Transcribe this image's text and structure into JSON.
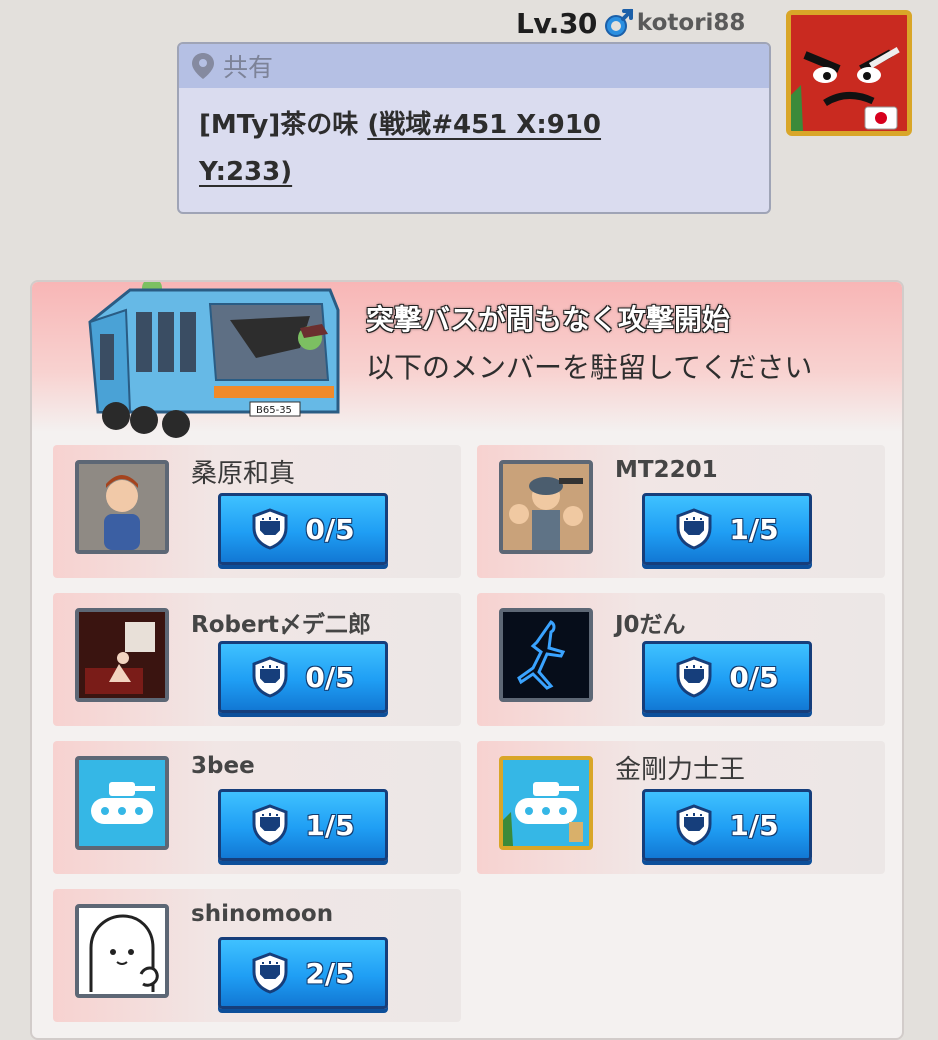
{
  "header": {
    "level": "Lv.30",
    "username": "kotori88",
    "gender_icon": "male-icon",
    "flag": "japan-flag"
  },
  "share": {
    "label": "共有",
    "alliance_player": "[MTy]茶の味",
    "location_line1": "(戦域#451 X:910",
    "location_line2": "Y:233)"
  },
  "attack": {
    "line1": "突撃バスが間もなく攻撃開始",
    "line2": "以下のメンバーを駐留してください"
  },
  "members": [
    {
      "name": "桑原和真",
      "count": "0/5"
    },
    {
      "name": "MT2201",
      "count": "1/5"
    },
    {
      "name": "Robert〆デ二郎",
      "count": "0/5"
    },
    {
      "name": "J0だん",
      "count": "0/5"
    },
    {
      "name": "3bee",
      "count": "1/5"
    },
    {
      "name": "金剛力士王",
      "count": "1/5"
    },
    {
      "name": "shinomoon",
      "count": "2/5"
    }
  ],
  "colors": {
    "button_blue": "#1f9ef4",
    "panel_pink": "#f8b6b6",
    "bubble_blue": "#b5c0e4"
  }
}
